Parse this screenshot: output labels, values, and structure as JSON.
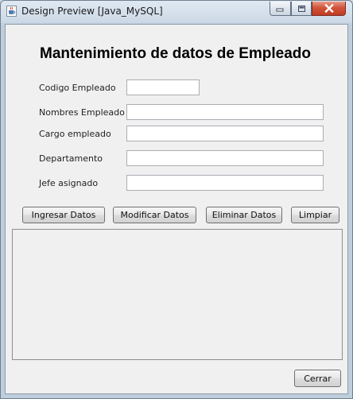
{
  "window": {
    "title": "Design Preview [Java_MySQL]",
    "icon": "java-coffee-icon"
  },
  "caption_buttons": {
    "minimize": "minimize-icon",
    "maximize": "maximize-icon",
    "close": "close-icon"
  },
  "form": {
    "heading": "Mantenimiento de datos de Empleado",
    "fields": [
      {
        "label": "Codigo Empleado",
        "value": ""
      },
      {
        "label": "Nombres Empleado",
        "value": ""
      },
      {
        "label": "Cargo empleado",
        "value": ""
      },
      {
        "label": "Departamento",
        "value": ""
      },
      {
        "label": "Jefe asignado",
        "value": ""
      }
    ]
  },
  "actions": {
    "insert": "Ingresar Datos",
    "modify": "Modificar Datos",
    "delete": "Eliminar Datos",
    "clear": "Limpiar"
  },
  "footer": {
    "close": "Cerrar"
  },
  "colors": {
    "close_button": "#c94b32",
    "client_bg": "#f0f0f0",
    "frame": "#bfcedc"
  }
}
